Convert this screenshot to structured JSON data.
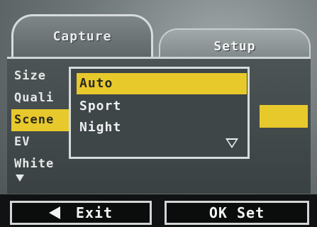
{
  "tabs": {
    "capture": "Capture",
    "setup": "Setup"
  },
  "menu": {
    "items": [
      "Size",
      "Quali",
      "Scene",
      "EV",
      "White"
    ],
    "selected_index": 2
  },
  "dropdown": {
    "options": [
      "Auto",
      "Sport",
      "Night"
    ],
    "selected": "Auto"
  },
  "buttons": {
    "exit": "Exit",
    "ok_set": "OK Set"
  },
  "colors": {
    "highlight": "#e8c92c",
    "panel": "#3e4647",
    "text": "#eef0f0"
  },
  "icons": {
    "exit": "left-arrow-icon",
    "more_menu": "down-arrow-icon",
    "more_options": "down-arrow-icon"
  }
}
